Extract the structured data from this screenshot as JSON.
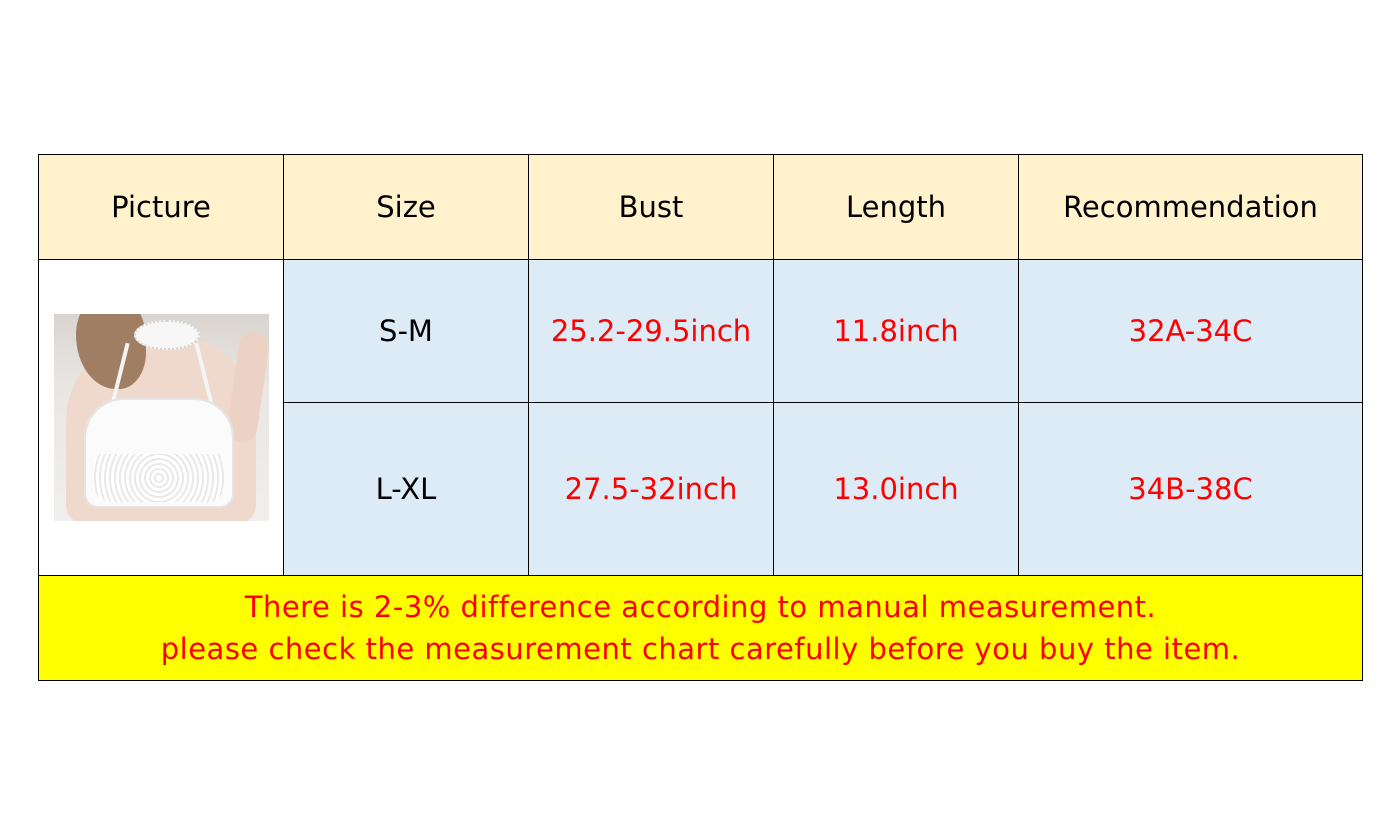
{
  "headers": [
    "Picture",
    "Size",
    "Bust",
    "Length",
    "Recommendation"
  ],
  "rows": [
    {
      "size": "S-M",
      "bust": "25.2-29.5inch",
      "length": "11.8inch",
      "recommendation": "32A-34C"
    },
    {
      "size": "L-XL",
      "bust": "27.5-32inch",
      "length": "13.0inch",
      "recommendation": "34B-38C"
    }
  ],
  "note": {
    "line1": "There is 2-3% difference according to manual measurement.",
    "line2": "please check the measurement chart carefully before you buy the item."
  },
  "picture": {
    "icon": "white-lace-crop-top-photo"
  },
  "colors": {
    "header_bg": "#fff2cc",
    "data_bg": "#ddebf7",
    "note_bg": "#ffff00",
    "value_text": "#ff0000"
  }
}
